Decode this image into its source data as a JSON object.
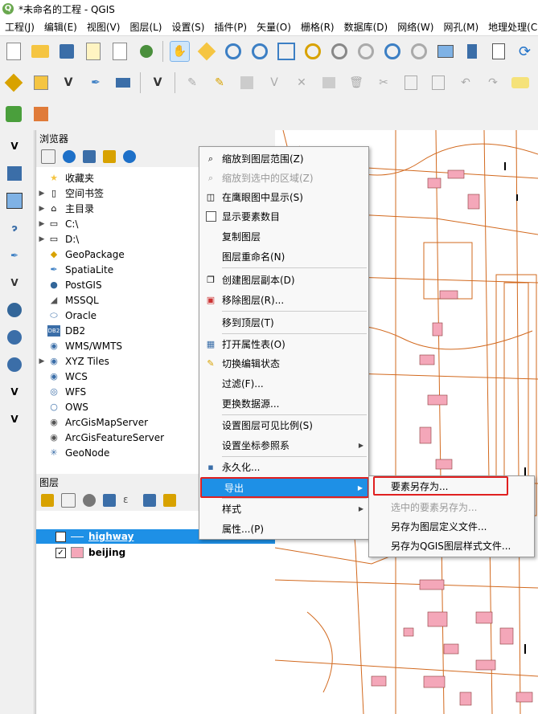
{
  "window": {
    "title": "*未命名的工程 - QGIS"
  },
  "menubar": [
    "工程(J)",
    "编辑(E)",
    "视图(V)",
    "图层(L)",
    "设置(S)",
    "插件(P)",
    "矢量(O)",
    "栅格(R)",
    "数据库(D)",
    "网络(W)",
    "网孔(M)",
    "地理处理(C"
  ],
  "browser": {
    "title": "浏览器",
    "items": [
      {
        "label": "收藏夹",
        "expand": false,
        "icon": "star-icon"
      },
      {
        "label": "空间书签",
        "expand": true,
        "icon": "bookmark-icon"
      },
      {
        "label": "主目录",
        "expand": true,
        "icon": "home-folder-icon"
      },
      {
        "label": "C:\\",
        "expand": true,
        "icon": "folder-icon"
      },
      {
        "label": "D:\\",
        "expand": true,
        "icon": "folder-icon"
      },
      {
        "label": "GeoPackage",
        "expand": false,
        "icon": "geopackage-icon"
      },
      {
        "label": "SpatiaLite",
        "expand": false,
        "icon": "feather-icon"
      },
      {
        "label": "PostGIS",
        "expand": false,
        "icon": "elephant-icon"
      },
      {
        "label": "MSSQL",
        "expand": false,
        "icon": "mssql-icon"
      },
      {
        "label": "Oracle",
        "expand": false,
        "icon": "oracle-icon"
      },
      {
        "label": "DB2",
        "expand": false,
        "icon": "db2-icon"
      },
      {
        "label": "WMS/WMTS",
        "expand": false,
        "icon": "globe-icon"
      },
      {
        "label": "XYZ Tiles",
        "expand": true,
        "icon": "globe-icon"
      },
      {
        "label": "WCS",
        "expand": false,
        "icon": "globe-icon"
      },
      {
        "label": "WFS",
        "expand": false,
        "icon": "wfs-icon"
      },
      {
        "label": "OWS",
        "expand": false,
        "icon": "ows-icon"
      },
      {
        "label": "ArcGisMapServer",
        "expand": false,
        "icon": "globe-icon"
      },
      {
        "label": "ArcGisFeatureServer",
        "expand": false,
        "icon": "globe-icon"
      },
      {
        "label": "GeoNode",
        "expand": false,
        "icon": "geonode-icon"
      }
    ]
  },
  "layers": {
    "title": "图层",
    "items": [
      {
        "label": "highway",
        "checked": "✓",
        "selected": true
      },
      {
        "label": "beijing",
        "checked": "✓",
        "selected": false
      }
    ]
  },
  "context_menu": {
    "items": [
      {
        "label": "缩放到图层范围(Z)",
        "icon": "zoom-layer-icon",
        "disabled": false
      },
      {
        "label": "缩放到选中的区域(Z)",
        "icon": "zoom-selection-icon",
        "disabled": true
      },
      {
        "label": "在鹰眼图中显示(S)",
        "icon": "overview-icon",
        "disabled": false
      },
      {
        "label": "显示要素数目",
        "icon": "checkbox-icon",
        "disabled": false
      },
      {
        "label": "复制图层",
        "icon": "",
        "disabled": false
      },
      {
        "label": "图层重命名(N)",
        "icon": "",
        "disabled": false
      },
      {
        "label": "创建图层副本(D)",
        "icon": "duplicate-icon",
        "disabled": false
      },
      {
        "label": "移除图层(R)...",
        "icon": "remove-layer-icon",
        "disabled": false
      },
      {
        "label": "移到顶层(T)",
        "icon": "",
        "disabled": false
      },
      {
        "label": "打开属性表(O)",
        "icon": "table-icon",
        "disabled": false
      },
      {
        "label": "切换编辑状态",
        "icon": "pencil-icon",
        "disabled": false
      },
      {
        "label": "过滤(F)...",
        "icon": "",
        "disabled": false
      },
      {
        "label": "更换数据源...",
        "icon": "",
        "disabled": false
      },
      {
        "label": "设置图层可见比例(S)",
        "icon": "",
        "disabled": false
      },
      {
        "label": "设置坐标参照系",
        "icon": "",
        "disabled": false
      },
      {
        "label": "永久化...",
        "icon": "save-icon",
        "disabled": false
      },
      {
        "label": "导出",
        "icon": "",
        "disabled": false
      },
      {
        "label": "样式",
        "icon": "",
        "disabled": false
      },
      {
        "label": "属性...(P)",
        "icon": "",
        "disabled": false
      }
    ]
  },
  "export_submenu": {
    "items": [
      {
        "label": "要素另存为...",
        "disabled": false
      },
      {
        "label": "选中的要素另存为...",
        "disabled": true
      },
      {
        "label": "另存为图层定义文件...",
        "disabled": false
      },
      {
        "label": "另存为QGIS图层样式文件...",
        "disabled": false
      }
    ]
  },
  "colors": {
    "map_lines": "#d2691e",
    "map_fill": "#f4a7b9",
    "highlight": "#1e90e6",
    "red_box": "#e02020"
  }
}
